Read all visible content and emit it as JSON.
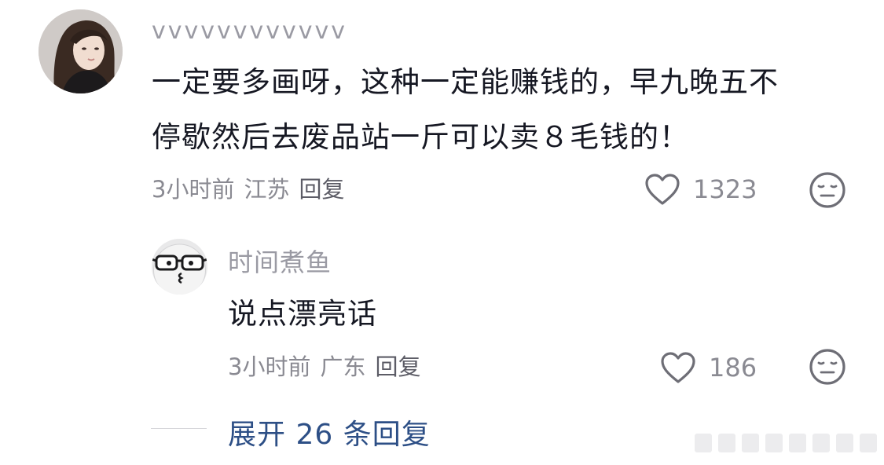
{
  "comment": {
    "username": "vvvvvvvvvvvv",
    "text_line1": "一定要多画呀，这种一定能赚钱的，早九晚五不",
    "text_line2": "停歇然后去废品站一斤可以卖８毛钱的！",
    "time": "3小时前",
    "location": "江苏",
    "reply_label": "回复",
    "like_count": "1323",
    "like_icon": "heart-outline-icon",
    "emoji_icon": "neutral-face-icon"
  },
  "reply": {
    "username": "时间煮鱼",
    "text": "说点漂亮话",
    "time": "3小时前",
    "location": "广东",
    "reply_label": "回复",
    "like_count": "186",
    "like_icon": "heart-outline-icon",
    "emoji_icon": "neutral-face-icon"
  },
  "expand": {
    "label": "展开 26 条回复"
  },
  "colors": {
    "text_primary": "#161823",
    "text_secondary": "#8a8a92",
    "link_blue": "#2d4f86",
    "background": "#ffffff"
  }
}
